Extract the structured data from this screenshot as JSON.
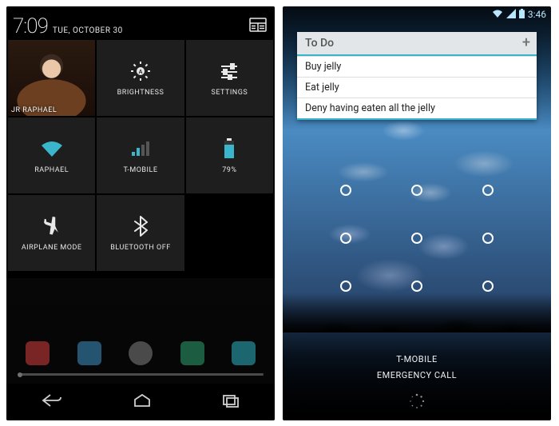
{
  "left": {
    "status": {
      "time": "7:09",
      "date": "TUE, OCTOBER 30"
    },
    "tiles": [
      {
        "key": "profile",
        "label": "JR RAPHAEL",
        "icon": "avatar"
      },
      {
        "key": "brightness",
        "label": "BRIGHTNESS",
        "icon": "brightness-icon"
      },
      {
        "key": "settings",
        "label": "SETTINGS",
        "icon": "sliders-icon"
      },
      {
        "key": "wifi",
        "label": "RAPHAEL",
        "icon": "wifi-icon"
      },
      {
        "key": "cell",
        "label": "T-MOBILE",
        "icon": "cell-signal-icon"
      },
      {
        "key": "battery",
        "label": "79%",
        "icon": "battery-icon"
      },
      {
        "key": "airplane",
        "label": "AIRPLANE MODE",
        "icon": "airplane-icon"
      },
      {
        "key": "bluetooth",
        "label": "BLUETOOTH OFF",
        "icon": "bluetooth-icon"
      }
    ]
  },
  "right": {
    "status": {
      "time": "3:46"
    },
    "widget": {
      "title": "To Do",
      "items": [
        "Buy jelly",
        "Eat jelly",
        "Deny having eaten all the jelly"
      ]
    },
    "carrier": "T-MOBILE",
    "emergency": "EMERGENCY CALL"
  },
  "colors": {
    "holo_blue": "#3bb5cc",
    "status_blue": "#b9e6ff"
  }
}
